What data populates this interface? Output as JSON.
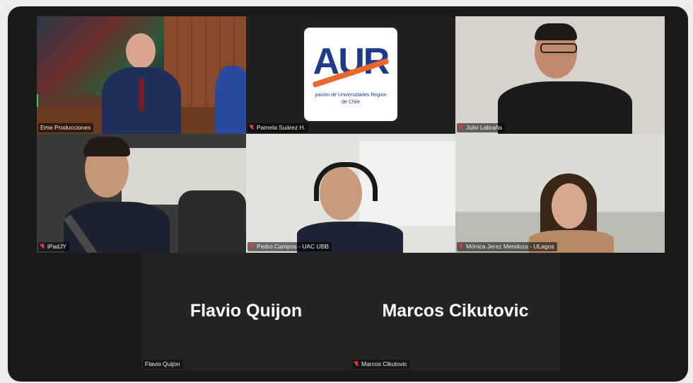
{
  "participants": [
    {
      "name": "Eme Producciones",
      "muted": false,
      "active": true
    },
    {
      "name": "Pamela Suárez H.",
      "muted": true,
      "logo": {
        "letters": "AUR",
        "line1": "pación de Universidades Region",
        "line2": "de Chile"
      }
    },
    {
      "name": "Julio Labraña",
      "muted": true
    },
    {
      "name": "iPadJY",
      "muted": true
    },
    {
      "name": "Pedro Campos - UAC UBB",
      "muted": true
    },
    {
      "name": "Mónica Jerez Mendoza - ULagos",
      "muted": true
    },
    {
      "name": "Flavio Quijon",
      "muted": false,
      "display_name": "Flavio Quijon"
    },
    {
      "name": "Marcos Cikutovic",
      "muted": true,
      "display_name": "Marcos Cikutovic"
    }
  ],
  "colors": {
    "active_border": "#23d96a",
    "mic_muted": "#e23b3b",
    "tile_bg": "#242424"
  }
}
